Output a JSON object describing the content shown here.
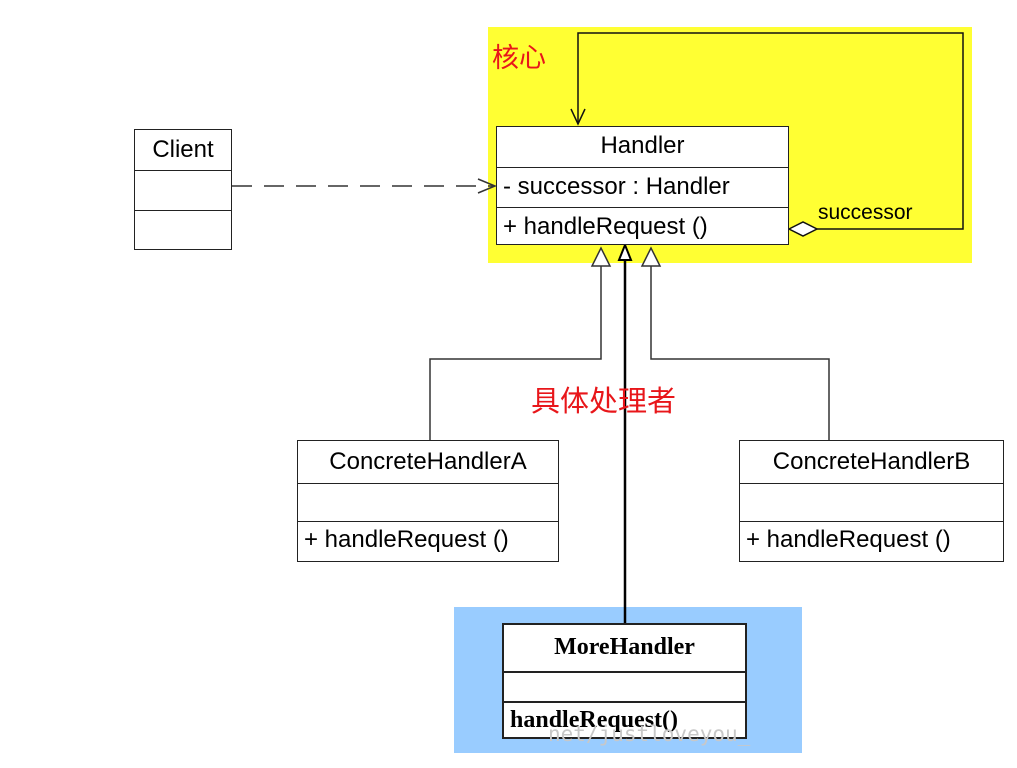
{
  "annotations": {
    "core_label": "核心",
    "concrete_label": "具体处理者",
    "successor_role": "successor"
  },
  "classes": {
    "client": {
      "name": "Client"
    },
    "handler": {
      "name": "Handler",
      "attribute": "- successor : Handler",
      "operation": "+ handleRequest ()"
    },
    "concrete_a": {
      "name": "ConcreteHandlerA",
      "operation": "+ handleRequest ()"
    },
    "concrete_b": {
      "name": "ConcreteHandlerB",
      "operation": "+ handleRequest ()"
    },
    "more_handler": {
      "name": "MoreHandler",
      "operation": "handleRequest()"
    }
  },
  "watermark": "net/justloveyou_",
  "colors": {
    "core_region": "#ffff33",
    "extension_region": "#99ccff",
    "annotation_text": "#e8161a"
  }
}
